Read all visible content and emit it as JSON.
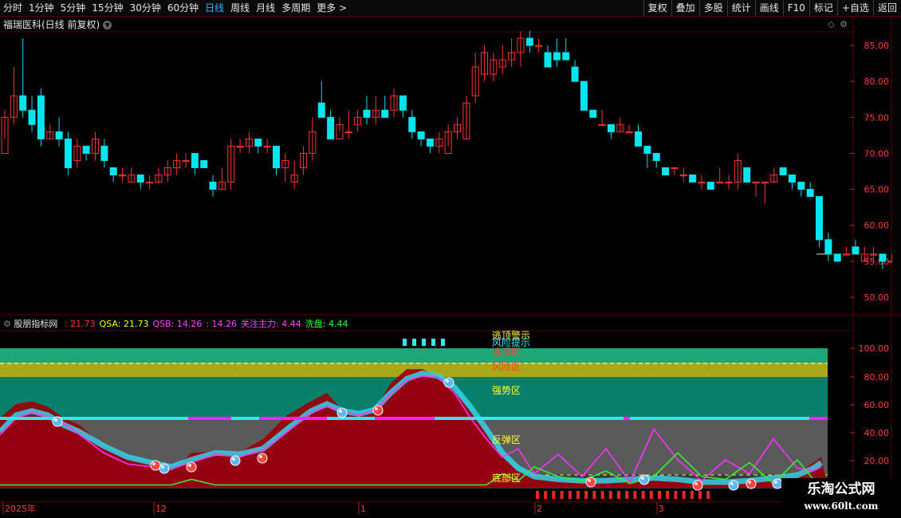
{
  "periods": [
    "分时",
    "1分钟",
    "5分钟",
    "15分钟",
    "30分钟",
    "60分钟",
    "日线",
    "周线",
    "月线",
    "多周期",
    "更多 >"
  ],
  "active_period": "日线",
  "toolbar": [
    "复权",
    "叠加",
    "多股",
    "统计",
    "画线",
    "F10",
    "标记",
    "+自选",
    "返回"
  ],
  "stock_title": "福瑞医科(日线 前复权)",
  "price_axis": [
    "85.00",
    "80.00",
    "75.00",
    "70.00",
    "65.00",
    "60.00",
    "55.00",
    "50.00"
  ],
  "indicator": {
    "name": "股朋指标网",
    "values": [
      {
        "text": ": 21.73",
        "color": "#ff3333"
      },
      {
        "text": "QSA: 21.73",
        "color": "#ffff00"
      },
      {
        "text": "QSB: 14.26",
        "color": "#ff44ff"
      },
      {
        "text": ": 14.26",
        "color": "#ff44ff"
      },
      {
        "text": "关注主力: 4.44",
        "color": "#ff44ff"
      },
      {
        "text": "洗盘: 4.44",
        "color": "#33ff33"
      }
    ],
    "zones": [
      "逃顶警示",
      "风险提示",
      "逃顶区",
      "风险区",
      "强势区",
      "反弹区",
      "底部区"
    ],
    "axis": [
      "100.00",
      "80.00",
      "60.00",
      "40.00",
      "20.00"
    ]
  },
  "date_axis": [
    "2025年",
    "12",
    "1",
    "2",
    "3"
  ],
  "watermark": {
    "line1": "乐淘公式网",
    "line2": "www.60lt.com"
  },
  "colors": {
    "up": "#ff3232",
    "down": "#00e5ee",
    "active": "#31b4ff",
    "grid": "#5a0000"
  },
  "candles": [
    [
      70,
      75,
      76,
      72
    ],
    [
      75,
      78,
      82,
      74
    ],
    [
      78,
      76,
      86,
      75
    ],
    [
      76,
      74,
      78,
      73
    ],
    [
      78,
      72,
      79,
      71
    ],
    [
      72,
      73,
      74,
      72
    ],
    [
      73,
      72,
      75,
      71
    ],
    [
      72,
      68,
      73,
      67
    ],
    [
      69,
      71,
      72,
      68
    ],
    [
      71,
      70,
      71,
      69
    ],
    [
      70,
      72,
      73,
      69
    ],
    [
      71,
      69,
      72,
      68
    ],
    [
      68,
      67,
      68,
      66
    ],
    [
      67,
      67,
      68,
      66
    ],
    [
      66,
      67,
      68,
      66
    ],
    [
      67,
      66,
      67,
      65
    ],
    [
      66,
      66,
      67,
      65
    ],
    [
      66,
      67,
      68,
      66
    ],
    [
      67,
      68,
      69,
      66
    ],
    [
      68,
      69,
      70,
      67
    ],
    [
      69,
      69,
      70,
      68
    ],
    [
      70,
      68,
      70,
      67
    ],
    [
      69,
      68,
      69,
      68
    ],
    [
      66,
      65,
      67,
      64
    ],
    [
      65,
      66,
      68,
      65
    ],
    [
      66,
      71,
      72,
      65
    ],
    [
      71,
      71,
      72,
      70
    ],
    [
      71,
      72,
      73,
      70
    ],
    [
      72,
      71,
      72,
      70
    ],
    [
      71,
      71,
      72,
      70
    ],
    [
      71,
      68,
      71,
      67
    ],
    [
      68,
      69,
      70,
      66
    ],
    [
      66,
      67,
      69,
      65
    ],
    [
      68,
      70,
      71,
      67
    ],
    [
      70,
      73,
      75,
      69
    ],
    [
      77,
      75,
      80,
      75
    ],
    [
      75,
      72,
      76,
      72
    ],
    [
      72,
      74,
      75,
      73
    ],
    [
      73,
      73,
      76,
      72
    ],
    [
      74,
      75,
      76,
      73
    ],
    [
      76,
      75,
      78,
      74
    ],
    [
      75,
      76,
      78,
      74
    ],
    [
      76,
      75,
      78,
      75
    ],
    [
      76,
      78,
      79,
      75
    ],
    [
      78,
      76,
      78,
      75
    ],
    [
      75,
      73,
      76,
      72
    ],
    [
      73,
      72,
      73,
      71
    ],
    [
      72,
      71,
      72,
      70
    ],
    [
      71,
      72,
      73,
      70
    ],
    [
      70,
      73,
      74,
      71
    ],
    [
      73,
      74,
      75,
      72
    ],
    [
      72,
      77,
      78,
      72
    ],
    [
      78,
      82,
      84,
      77
    ],
    [
      81,
      84,
      85,
      80
    ],
    [
      81,
      83,
      84,
      80
    ],
    [
      82,
      83,
      85,
      81
    ],
    [
      83,
      84,
      86,
      82
    ],
    [
      84,
      86,
      87,
      82
    ],
    [
      86,
      85,
      87,
      84
    ],
    [
      85,
      85,
      86,
      84
    ],
    [
      84,
      82,
      85,
      82
    ],
    [
      84,
      83,
      86,
      82
    ],
    [
      84,
      83,
      86,
      83
    ],
    [
      82,
      80,
      83,
      80
    ],
    [
      80,
      76,
      80,
      76
    ],
    [
      76,
      75,
      76,
      75
    ],
    [
      74,
      74,
      76,
      74
    ],
    [
      74,
      73,
      74,
      72
    ],
    [
      73,
      74,
      75,
      73
    ],
    [
      73,
      73,
      74,
      73
    ],
    [
      73,
      71,
      74,
      71
    ],
    [
      71,
      70,
      71,
      68
    ],
    [
      70,
      69,
      70,
      68
    ],
    [
      68,
      67,
      68,
      67
    ],
    [
      68,
      68,
      68,
      67
    ],
    [
      67,
      67,
      68,
      66
    ],
    [
      67,
      66,
      67,
      66
    ],
    [
      66,
      66,
      67,
      65
    ],
    [
      66,
      65,
      66,
      65
    ],
    [
      66,
      66,
      68,
      66
    ],
    [
      66,
      66,
      67,
      65
    ],
    [
      66,
      69,
      70,
      65
    ],
    [
      68,
      66,
      68,
      66
    ],
    [
      66,
      66,
      66,
      64
    ],
    [
      66,
      66,
      66,
      63
    ],
    [
      66,
      67,
      68,
      66
    ],
    [
      68,
      67,
      68,
      67
    ],
    [
      67,
      66,
      67,
      65
    ],
    [
      66,
      65,
      66,
      64
    ],
    [
      65,
      64,
      66,
      64
    ],
    [
      64,
      58,
      64,
      57
    ],
    [
      58,
      56,
      59,
      55
    ],
    [
      56,
      55,
      56,
      55
    ],
    [
      56,
      56,
      57,
      56
    ],
    [
      57,
      56,
      58,
      56
    ],
    [
      55,
      56,
      57,
      55
    ],
    [
      56,
      56,
      57,
      55
    ],
    [
      56,
      55,
      56,
      54
    ],
    [
      55,
      55,
      56,
      55
    ],
    [
      55,
      54,
      55,
      54
    ],
    [
      54,
      53,
      55,
      52
    ],
    [
      53,
      53,
      54,
      52
    ],
    [
      53,
      54,
      55,
      53
    ],
    [
      54,
      53,
      54,
      52
    ],
    [
      53,
      53,
      53,
      52
    ],
    [
      53,
      52,
      53,
      52
    ],
    [
      52,
      51,
      53,
      51
    ],
    [
      51,
      50,
      51,
      49
    ],
    [
      51,
      53,
      53,
      50
    ],
    [
      53,
      56,
      57,
      53
    ],
    [
      56,
      56,
      56,
      56
    ]
  ]
}
